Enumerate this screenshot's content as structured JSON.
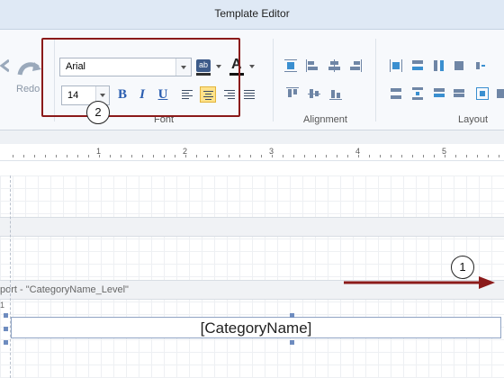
{
  "window": {
    "title": "Template Editor"
  },
  "ribbon": {
    "redo_label": "Redo",
    "font_group": {
      "label": "Font",
      "font_name": "Arial",
      "font_size": "14",
      "bold_label": "B",
      "italic_label": "I",
      "underline_label": "U",
      "highlight_label": "ab",
      "font_color_label": "A",
      "active_alignment": "center"
    },
    "alignment_group": {
      "label": "Alignment"
    },
    "layout_group": {
      "label": "Layout"
    }
  },
  "ruler": {
    "numbers": [
      "1",
      "2",
      "3",
      "4",
      "5"
    ]
  },
  "canvas": {
    "band_label": "port - \"CategoryName_Level\"",
    "band_marker": "1",
    "field_text": "[CategoryName]"
  },
  "annotations": {
    "callout_1": "1",
    "callout_2": "2"
  },
  "colors": {
    "annotation": "#8b1a1a",
    "active_button": "#ffe28a",
    "title_bar": "#dfe9f5"
  }
}
